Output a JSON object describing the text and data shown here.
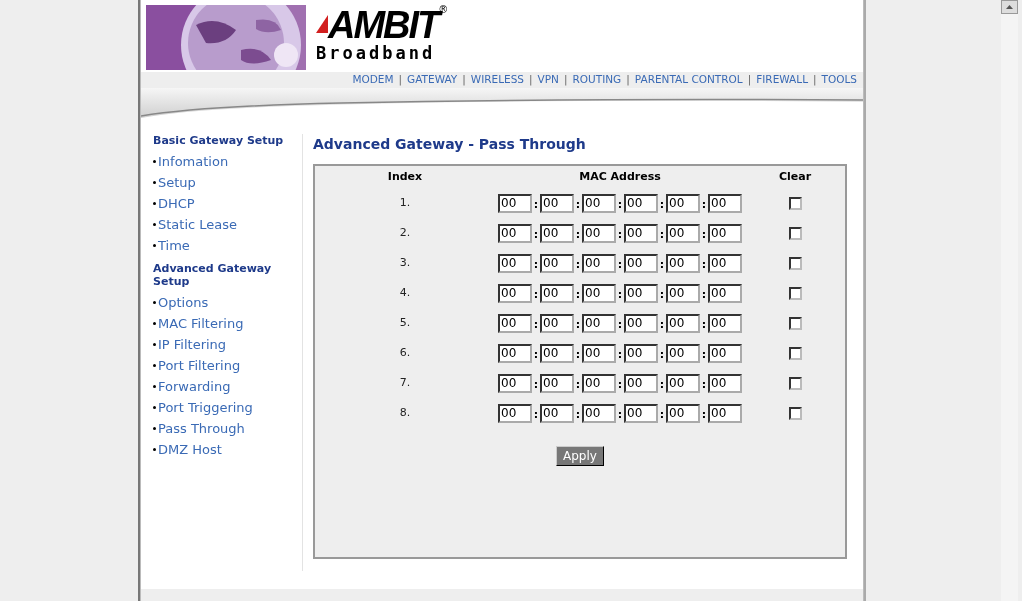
{
  "logo": {
    "name": "AMBIT",
    "mark": "®",
    "subtitle": "Broadband"
  },
  "nav": {
    "separator": "|",
    "items": [
      "MODEM",
      "GATEWAY",
      "WIRELESS",
      "VPN",
      "ROUTING",
      "PARENTAL CONTROL",
      "FIREWALL",
      "TOOLS"
    ]
  },
  "sidebar": [
    {
      "kind": "heading",
      "label": "Basic Gateway Setup"
    },
    {
      "kind": "link",
      "label": "Infomation"
    },
    {
      "kind": "link",
      "label": "Setup"
    },
    {
      "kind": "link",
      "label": "DHCP"
    },
    {
      "kind": "link",
      "label": "Static Lease"
    },
    {
      "kind": "link",
      "label": "Time"
    },
    {
      "kind": "heading",
      "label": "Advanced Gateway Setup"
    },
    {
      "kind": "link",
      "label": "Options"
    },
    {
      "kind": "link",
      "label": "MAC Filtering"
    },
    {
      "kind": "link",
      "label": "IP Filtering"
    },
    {
      "kind": "link",
      "label": "Port Filtering"
    },
    {
      "kind": "link",
      "label": "Forwarding"
    },
    {
      "kind": "link",
      "label": "Port Triggering"
    },
    {
      "kind": "link",
      "label": "Pass Through"
    },
    {
      "kind": "link",
      "label": "DMZ Host"
    }
  ],
  "title": "Advanced Gateway - Pass Through",
  "table": {
    "columns": [
      "Index",
      "MAC Address",
      "Clear"
    ],
    "separator": ":",
    "rows": [
      {
        "index": "1.",
        "mac": [
          "00",
          "00",
          "00",
          "00",
          "00",
          "00"
        ],
        "clear": false
      },
      {
        "index": "2.",
        "mac": [
          "00",
          "00",
          "00",
          "00",
          "00",
          "00"
        ],
        "clear": false
      },
      {
        "index": "3.",
        "mac": [
          "00",
          "00",
          "00",
          "00",
          "00",
          "00"
        ],
        "clear": false
      },
      {
        "index": "4.",
        "mac": [
          "00",
          "00",
          "00",
          "00",
          "00",
          "00"
        ],
        "clear": false
      },
      {
        "index": "5.",
        "mac": [
          "00",
          "00",
          "00",
          "00",
          "00",
          "00"
        ],
        "clear": false
      },
      {
        "index": "6.",
        "mac": [
          "00",
          "00",
          "00",
          "00",
          "00",
          "00"
        ],
        "clear": false
      },
      {
        "index": "7.",
        "mac": [
          "00",
          "00",
          "00",
          "00",
          "00",
          "00"
        ],
        "clear": false
      },
      {
        "index": "8.",
        "mac": [
          "00",
          "00",
          "00",
          "00",
          "00",
          "00"
        ],
        "clear": false
      }
    ]
  },
  "apply_button": "Apply"
}
